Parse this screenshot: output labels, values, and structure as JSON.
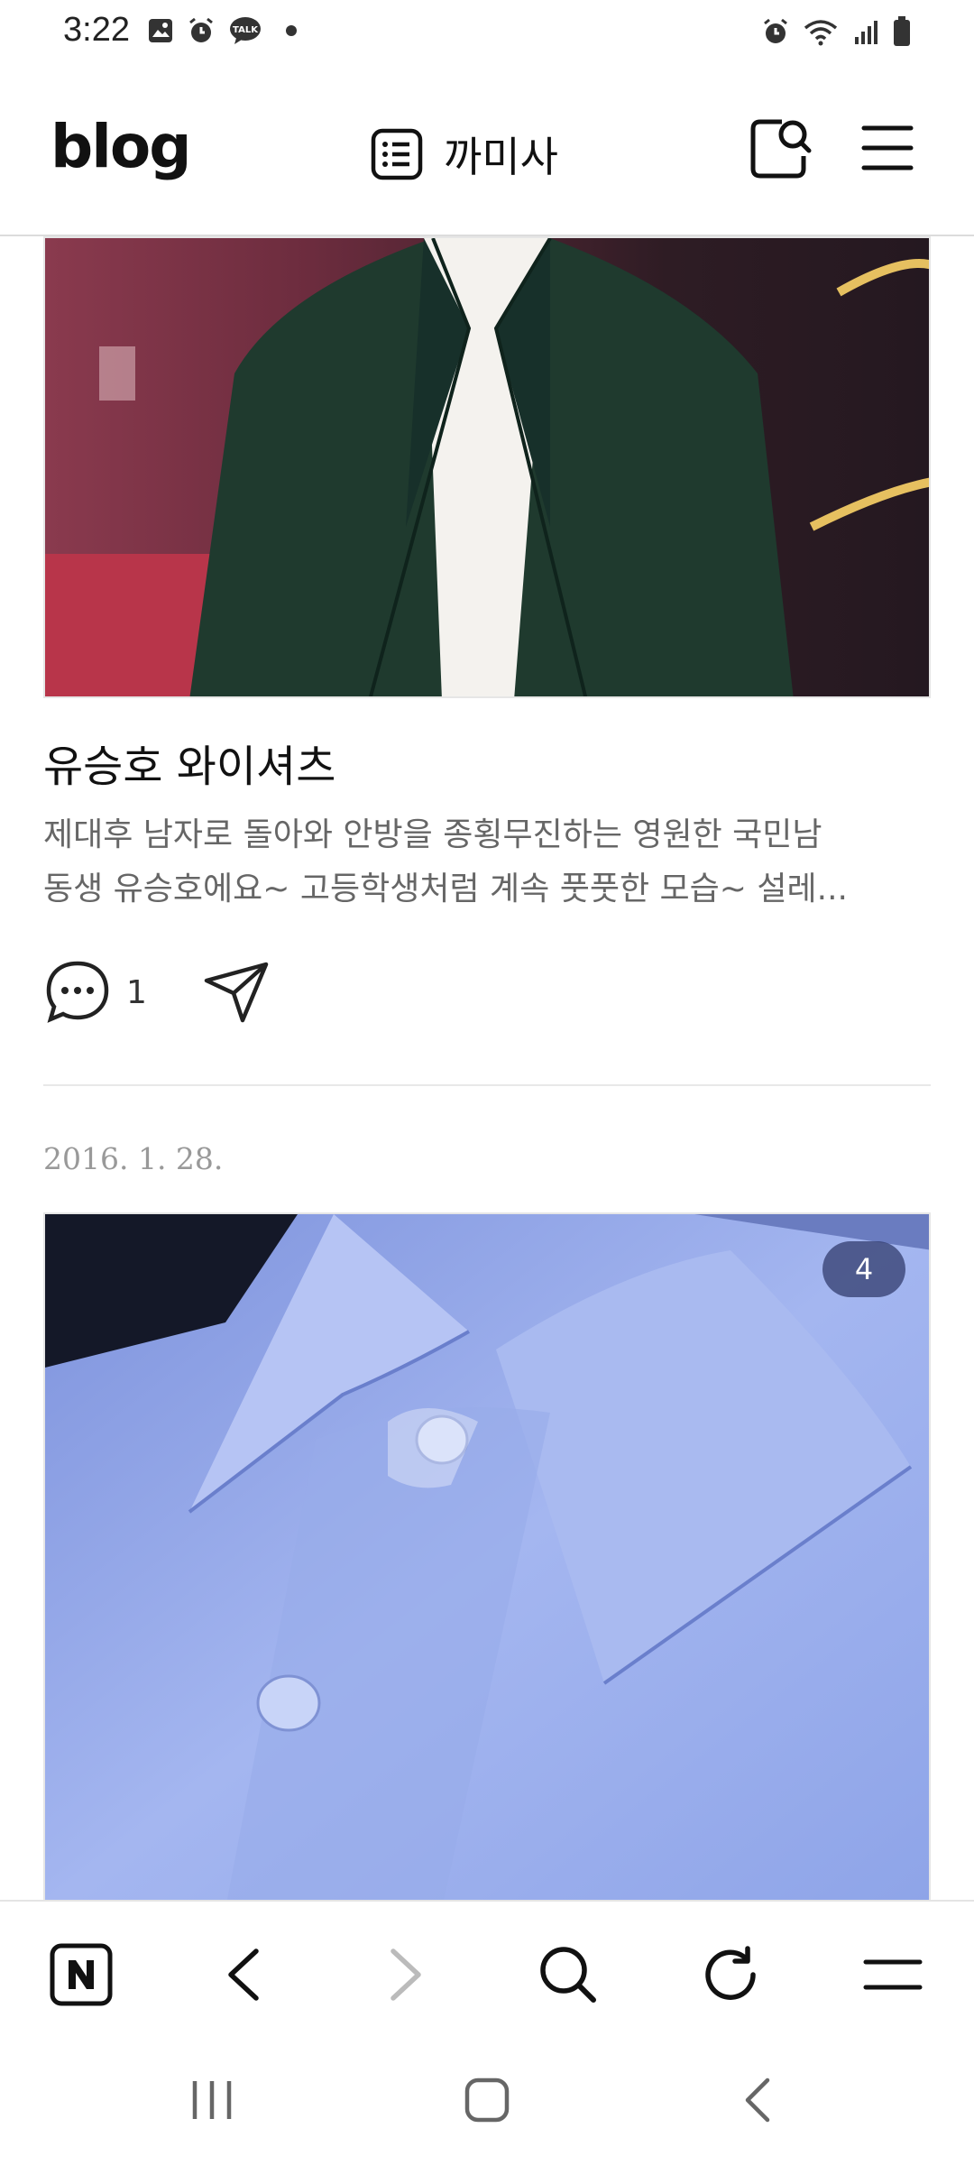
{
  "status_bar": {
    "time": "3:22",
    "left_icons": [
      "gallery-icon",
      "alarm-icon",
      "talk-icon"
    ],
    "right_icons": [
      "alarm-icon",
      "wifi-icon",
      "signal-icon",
      "battery-icon"
    ]
  },
  "header": {
    "logo": "blog",
    "blog_name": "까미사",
    "icons": [
      "list-icon",
      "search-profile-icon",
      "menu-icon"
    ]
  },
  "posts": [
    {
      "title": "유승호 와이셔츠",
      "excerpt_line1": "제대후 남자로 돌아와 안방을 종횡무진하는 영원한 국민남",
      "excerpt_line2": "동생 유승호에요~ 고등학생처럼 계속 풋풋한 모습~ 설레...",
      "comment_count": "1"
    },
    {
      "date": "2016. 1. 28.",
      "image_count": "4"
    }
  ],
  "browser_bar": {
    "icons": [
      "naver-home-icon",
      "back-icon",
      "forward-icon",
      "search-icon",
      "refresh-icon",
      "menu-icon"
    ]
  },
  "system_nav": {
    "icons": [
      "recent-apps-icon",
      "home-icon",
      "back-icon"
    ]
  },
  "colors": {
    "jacket": "#1f3a2e",
    "shirt_blue": "#8fa6e8",
    "badge": "#323c6e",
    "excerpt": "#666666",
    "date": "#999999"
  }
}
